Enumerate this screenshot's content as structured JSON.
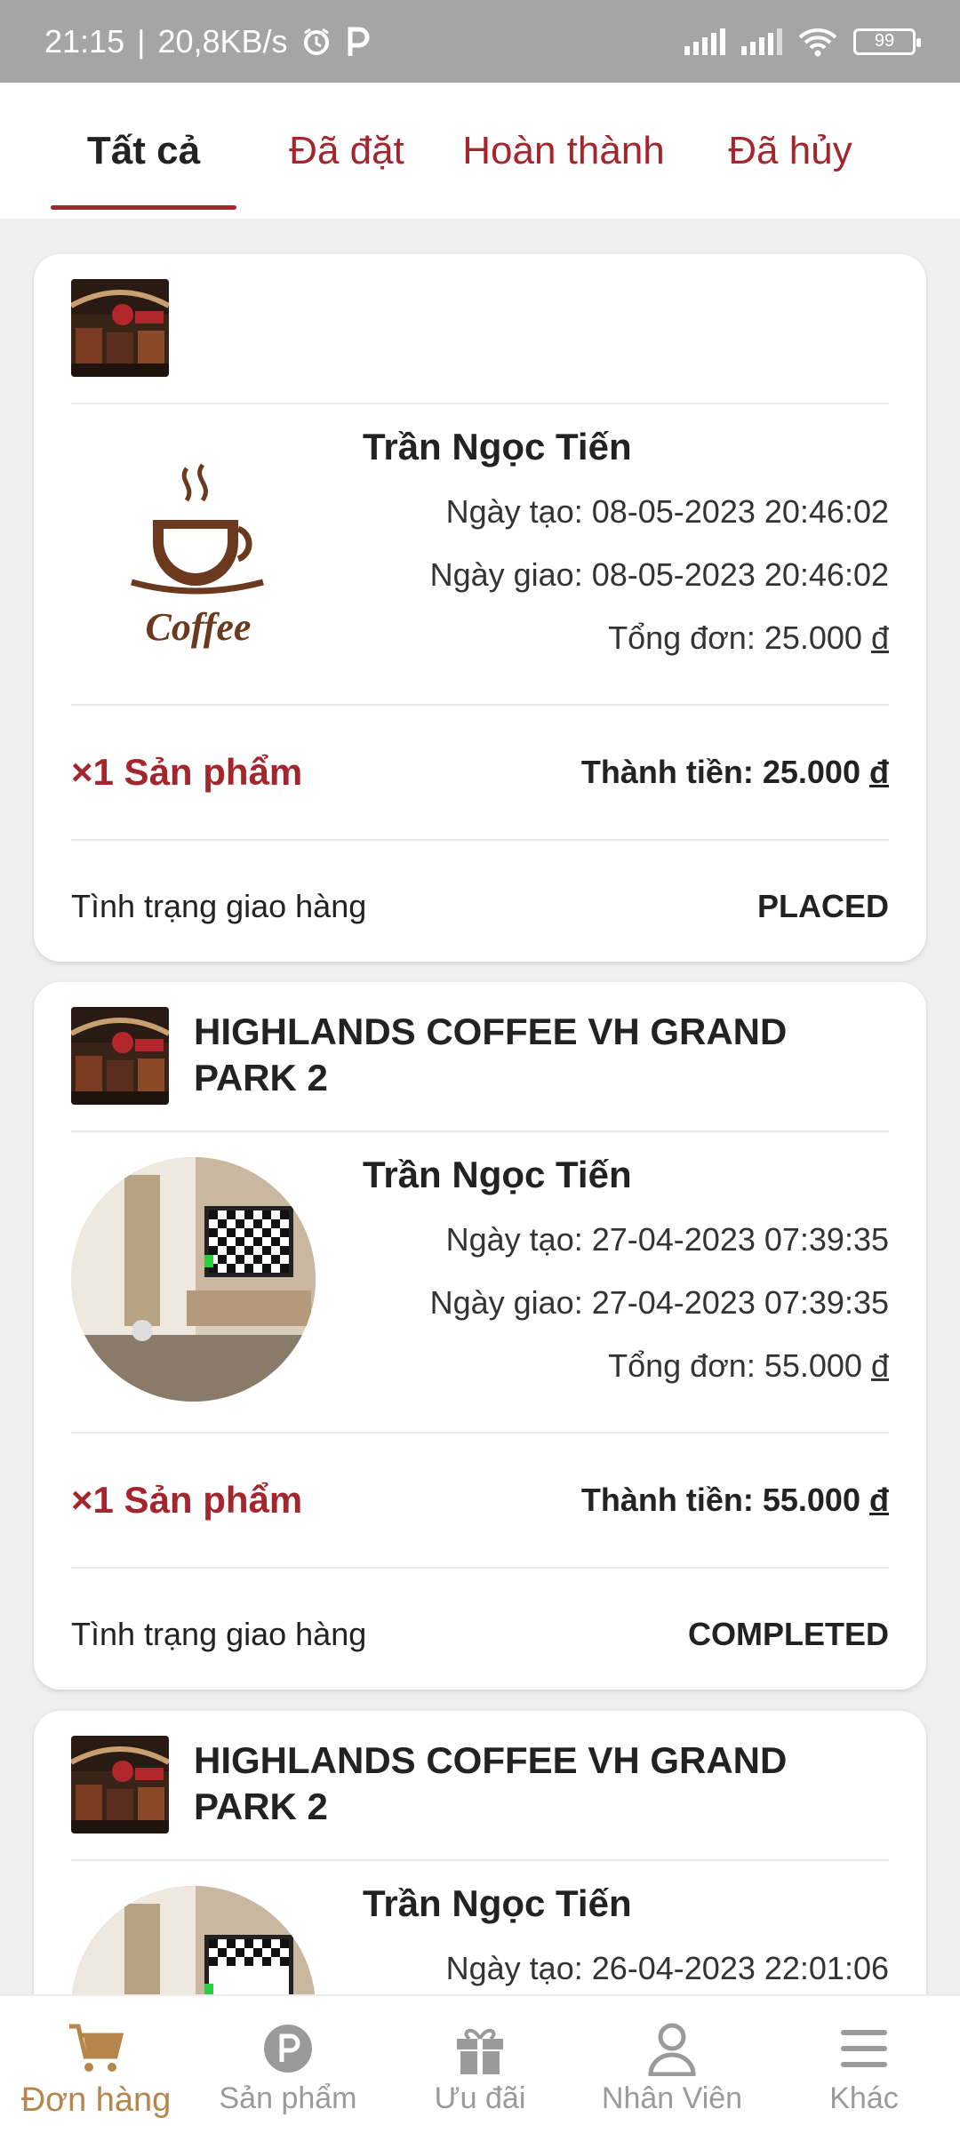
{
  "status_bar": {
    "time": "21:15",
    "speed": "20,8KB/s",
    "battery": "99",
    "icons": [
      "alarm-icon",
      "parking-app-icon",
      "signal-icon",
      "signal-icon",
      "wifi-icon",
      "battery-icon"
    ]
  },
  "tabs": [
    {
      "label": "Tất cả",
      "active": true
    },
    {
      "label": "Đã đặt",
      "active": false
    },
    {
      "label": "Hoàn thành",
      "active": false
    },
    {
      "label": "Đã hủy",
      "active": false
    }
  ],
  "orders": [
    {
      "store_name": "",
      "customer": "Trần Ngọc Tiến",
      "created": "Ngày tạo: 08-05-2023 20:46:02",
      "delivered": "Ngày giao: 08-05-2023 20:46:02",
      "order_total_label": "Tổng đơn: 25.000",
      "quantity": "×1 Sản phẩm",
      "amount_label": "Thành tiền: 25.000",
      "status_label": "Tình trạng giao hàng",
      "status": "PLACED",
      "logo_text": "Coffee"
    },
    {
      "store_name": "HIGHLANDS COFFEE VH GRAND PARK 2",
      "customer": "Trần Ngọc Tiến",
      "created": "Ngày tạo: 27-04-2023 07:39:35",
      "delivered": "Ngày giao: 27-04-2023 07:39:35",
      "order_total_label": "Tổng đơn: 55.000",
      "quantity": "×1 Sản phẩm",
      "amount_label": "Thành tiền: 55.000",
      "status_label": "Tình trạng giao hàng",
      "status": "COMPLETED"
    },
    {
      "store_name": "HIGHLANDS COFFEE VH GRAND PARK 2",
      "customer": "Trần Ngọc Tiến",
      "created": "Ngày tạo: 26-04-2023 22:01:06"
    }
  ],
  "currency": "đ",
  "bottom_nav": [
    {
      "label": "Đơn hàng",
      "icon": "cart-icon",
      "active": true
    },
    {
      "label": "Sản phẩm",
      "icon": "product-p-icon",
      "active": false
    },
    {
      "label": "Ưu đãi",
      "icon": "gift-icon",
      "active": false
    },
    {
      "label": "Nhân Viên",
      "icon": "person-icon",
      "active": false
    },
    {
      "label": "Khác",
      "icon": "menu-icon",
      "active": false
    }
  ],
  "colors": {
    "accent": "#a4262c",
    "nav_active": "#b5854c",
    "status_bar": "#a5a5a5"
  }
}
